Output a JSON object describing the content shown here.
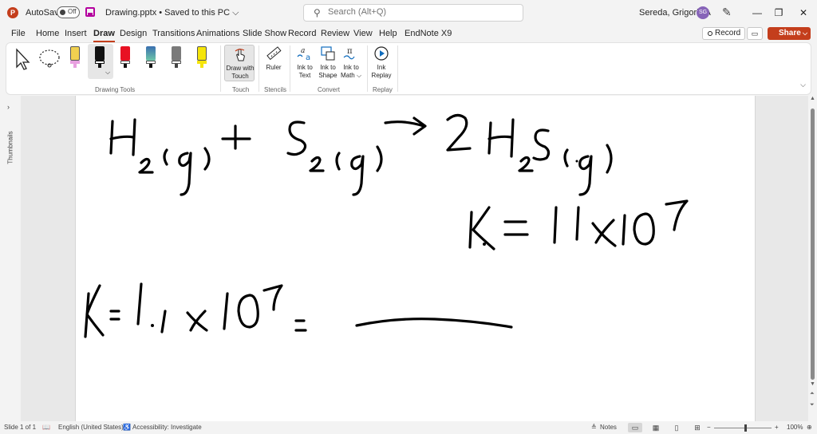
{
  "titlebar": {
    "autosave_label": "AutoSave",
    "autosave_state": "Off",
    "doc_title": "Drawing.pptx • Saved to this PC ⌵",
    "search_placeholder": "Search (Alt+Q)",
    "user_name": "Sereda, Grigoriy A",
    "user_initials": "SG"
  },
  "tabs": [
    "File",
    "Home",
    "Insert",
    "Draw",
    "Design",
    "Transitions",
    "Animations",
    "Slide Show",
    "Record",
    "Review",
    "View",
    "Help",
    "EndNote X9"
  ],
  "active_tab": "Draw",
  "actions": {
    "record": "Record",
    "share": "Share"
  },
  "ribbon": {
    "groups": {
      "drawing_tools": "Drawing Tools",
      "touch": "Touch",
      "stencils": "Stencils",
      "convert": "Convert",
      "replay": "Replay"
    },
    "buttons": {
      "draw_with_touch": [
        "Draw with",
        "Touch"
      ],
      "ruler": "Ruler",
      "ink_to_text": [
        "Ink to",
        "Text"
      ],
      "ink_to_shape": [
        "Ink to",
        "Shape"
      ],
      "ink_to_math": [
        "Ink to",
        "Math ⌵"
      ],
      "ink_replay": [
        "Ink",
        "Replay"
      ]
    },
    "pens": [
      {
        "name": "highlighter-pink",
        "color": "#e8a0e0"
      },
      {
        "name": "pen-black",
        "color": "#111111"
      },
      {
        "name": "pen-red",
        "color": "#e81123"
      },
      {
        "name": "pen-galaxy",
        "color": "#3a6fb0"
      },
      {
        "name": "pen-gray",
        "color": "#7a7a7a"
      },
      {
        "name": "highlighter-yellow",
        "color": "#f5e50a"
      }
    ]
  },
  "thumbnails_label": "Thumbnails",
  "slide_ink": {
    "equation": "H2(g) + S2(g) → 2H2S(g)",
    "k_value": "K = 1.1 × 10^7",
    "k_expression": "K = 1.1 × 10^7 ="
  },
  "statusbar": {
    "slide_info": "Slide 1 of 1",
    "language": "English (United States)",
    "accessibility": "Accessibility: Investigate",
    "notes": "Notes",
    "zoom": "100%"
  },
  "colors": {
    "accent": "#c43e1c",
    "ink": "#000000"
  }
}
